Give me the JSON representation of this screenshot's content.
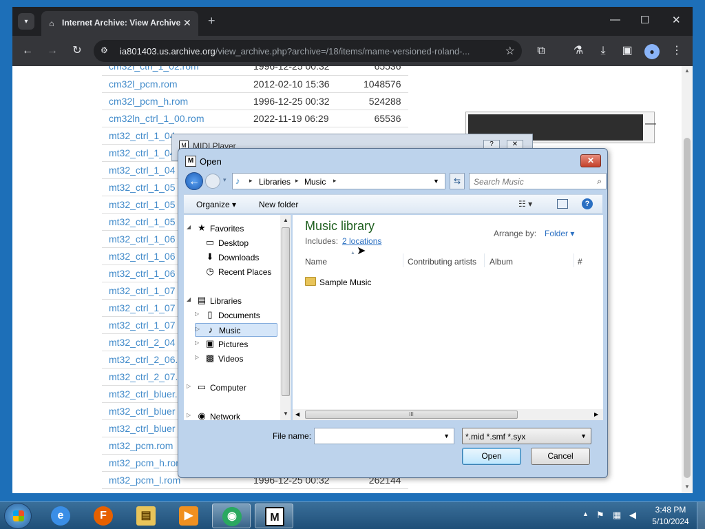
{
  "browser": {
    "tab_title": "Internet Archive: View Archive",
    "tab_favicon": "archive-building-icon",
    "url_host": "ia801403.us.archive.org",
    "url_path": "/view_archive.php?archive=/18/items/mame-versioned-roland-...",
    "page": {
      "files": [
        {
          "name": "cm32l_ctrl_1_02.rom",
          "date": "1996-12-25 00:32",
          "size": "65536"
        },
        {
          "name": "cm32l_pcm.rom",
          "date": "2012-02-10 15:36",
          "size": "1048576"
        },
        {
          "name": "cm32l_pcm_h.rom",
          "date": "1996-12-25 00:32",
          "size": "524288"
        },
        {
          "name": "cm32ln_ctrl_1_00.rom",
          "date": "2022-11-19 06:29",
          "size": "65536"
        },
        {
          "name": "mt32_ctrl_1_04",
          "date": "",
          "size": ""
        },
        {
          "name": "mt32_ctrl_1_04",
          "date": "",
          "size": ""
        },
        {
          "name": "mt32_ctrl_1_04",
          "date": "",
          "size": ""
        },
        {
          "name": "mt32_ctrl_1_05",
          "date": "",
          "size": ""
        },
        {
          "name": "mt32_ctrl_1_05",
          "date": "",
          "size": ""
        },
        {
          "name": "mt32_ctrl_1_05",
          "date": "",
          "size": ""
        },
        {
          "name": "mt32_ctrl_1_06",
          "date": "",
          "size": ""
        },
        {
          "name": "mt32_ctrl_1_06",
          "date": "",
          "size": ""
        },
        {
          "name": "mt32_ctrl_1_06",
          "date": "",
          "size": ""
        },
        {
          "name": "mt32_ctrl_1_07",
          "date": "",
          "size": ""
        },
        {
          "name": "mt32_ctrl_1_07",
          "date": "",
          "size": ""
        },
        {
          "name": "mt32_ctrl_1_07",
          "date": "",
          "size": ""
        },
        {
          "name": "mt32_ctrl_2_04",
          "date": "",
          "size": ""
        },
        {
          "name": "mt32_ctrl_2_06.",
          "date": "",
          "size": ""
        },
        {
          "name": "mt32_ctrl_2_07.",
          "date": "",
          "size": ""
        },
        {
          "name": "mt32_ctrl_bluer.",
          "date": "",
          "size": ""
        },
        {
          "name": "mt32_ctrl_bluer",
          "date": "",
          "size": ""
        },
        {
          "name": "mt32_ctrl_bluer",
          "date": "",
          "size": ""
        },
        {
          "name": "mt32_pcm.rom",
          "date": "",
          "size": ""
        },
        {
          "name": "mt32_pcm_h.rom",
          "date": "",
          "size": ""
        },
        {
          "name": "mt32_pcm_l.rom",
          "date": "1996-12-25 00:32",
          "size": "262144"
        }
      ]
    }
  },
  "midi_player": {
    "title": "MIDI Player",
    "help_label": "?",
    "close_label": "✕"
  },
  "dialog": {
    "title": "Open",
    "breadcrumb": [
      "Libraries",
      "Music"
    ],
    "search_placeholder": "Search Music",
    "organize_label": "Organize ▾",
    "new_folder_label": "New folder",
    "nav_tree": [
      {
        "label": "Favorites",
        "icon": "star-icon",
        "glyph": "★"
      },
      {
        "label": "Desktop",
        "icon": "desktop-icon",
        "glyph": "▭"
      },
      {
        "label": "Downloads",
        "icon": "downloads-icon",
        "glyph": "⬇"
      },
      {
        "label": "Recent Places",
        "icon": "recent-places-icon",
        "glyph": "◷"
      },
      {
        "label": "Libraries",
        "icon": "libraries-icon",
        "glyph": "▤"
      },
      {
        "label": "Documents",
        "icon": "documents-icon",
        "glyph": "▯"
      },
      {
        "label": "Music",
        "icon": "music-icon",
        "glyph": "♪"
      },
      {
        "label": "Pictures",
        "icon": "pictures-icon",
        "glyph": "▣"
      },
      {
        "label": "Videos",
        "icon": "videos-icon",
        "glyph": "▩"
      },
      {
        "label": "Computer",
        "icon": "computer-icon",
        "glyph": "▭"
      },
      {
        "label": "Network",
        "icon": "network-icon",
        "glyph": "◉"
      }
    ],
    "library_title": "Music library",
    "includes_label": "Includes:",
    "locations_link": "2 locations",
    "arrange_label": "Arrange by:",
    "arrange_value": "Folder ▾",
    "columns": [
      "Name",
      "Contributing artists",
      "Album",
      "#"
    ],
    "items": [
      {
        "name": "Sample Music",
        "icon": "folder-icon"
      }
    ],
    "file_name_label": "File name:",
    "file_name_value": "",
    "file_type": "*.mid *.smf *.syx",
    "open_label": "Open",
    "cancel_label": "Cancel",
    "hscroll_grip": "III"
  },
  "taskbar": {
    "apps": [
      {
        "name": "internet-explorer",
        "glyph": "e",
        "active": false
      },
      {
        "name": "firefox",
        "glyph": "F",
        "active": false
      },
      {
        "name": "windows-explorer",
        "glyph": "▤",
        "active": false
      },
      {
        "name": "media-player",
        "glyph": "▶",
        "active": false
      },
      {
        "name": "chrome",
        "glyph": "◉",
        "active": true
      },
      {
        "name": "midi-player",
        "glyph": "M",
        "active": true
      }
    ],
    "time": "3:48 PM",
    "date": "5/10/2024"
  },
  "colors": {
    "link_blue": "#428bca",
    "library_title_green": "#1e5f1e",
    "taskbar_top": "#3a6f9a",
    "dialog_frame": "#bdd3ec"
  }
}
